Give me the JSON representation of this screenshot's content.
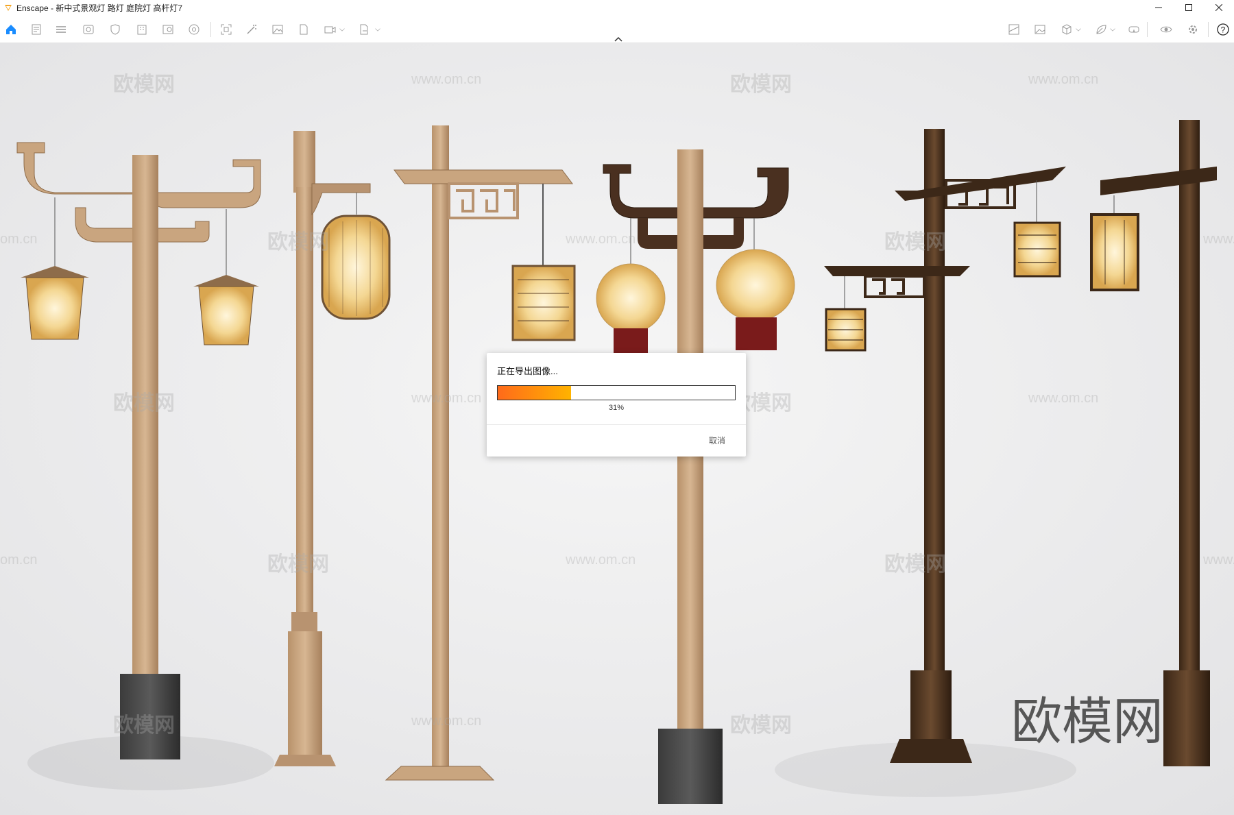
{
  "window": {
    "title": "Enscape - 新中式景观灯 路灯 庭院灯 高杆灯7"
  },
  "toolbar": {
    "left_icons": [
      "home-icon",
      "file-icon",
      "list-icon",
      "views-icon",
      "shield-icon",
      "building-icon",
      "asset-add-icon",
      "settings-wheel-icon",
      "frame-icon",
      "magic-icon",
      "image-icon",
      "document-icon",
      "video-icon",
      "export-icon"
    ],
    "right_icons": [
      "map-icon",
      "gallery-icon",
      "cube-icon",
      "leaf-icon",
      "vr-icon",
      "eye-icon",
      "gear-icon",
      "help-icon"
    ]
  },
  "dialog": {
    "title": "正在导出图像...",
    "progress_label": "31%",
    "progress": 0.31,
    "cancel_label": "取消"
  },
  "watermarks": {
    "brand": "欧模网",
    "url": "www.om.cn",
    "url_partial": "om.cn",
    "url_prefix": "www."
  },
  "colors": {
    "accent": "#1a8cff",
    "progress_start": "#ff6a1a",
    "progress_end": "#ffb300"
  }
}
